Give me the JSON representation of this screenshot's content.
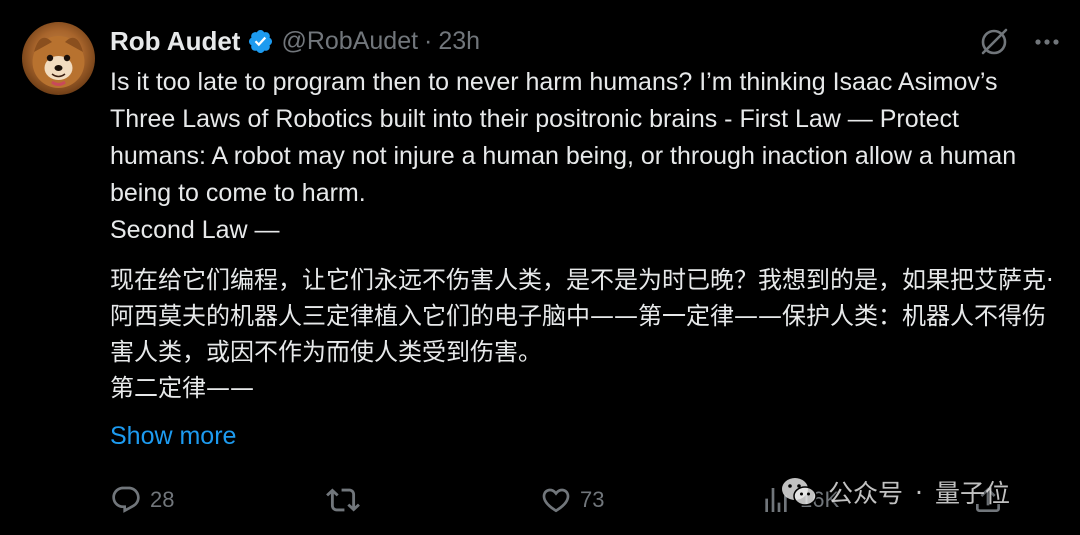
{
  "tweet": {
    "author": {
      "display_name": "Rob Audet",
      "handle": "@RobAudet",
      "separator": "·",
      "time": "23h",
      "verified": true,
      "avatar_icon": "dog-avatar"
    },
    "text_en": [
      "Is it too late to program then to never harm humans? I’m thinking Isaac Asimov’s Three Laws of Robotics built into their positronic brains - First Law — Protect humans: A robot may not injure a human being, or through inaction allow a human being to come to harm.",
      "Second Law —"
    ],
    "text_zh": [
      "现在给它们编程，让它们永远不伤害人类，是不是为时已晚？我想到的是，如果把艾萨克·阿西莫夫的机器人三定律植入它们的电子脑中——第一定律——保护人类：机器人不得伤害人类，或因不作为而使人类受到伤害。",
      "第二定律——"
    ],
    "show_more": "Show more",
    "actions": {
      "reply_count": "28",
      "retweet_count": "",
      "like_count": "73",
      "views_count": "16K"
    }
  },
  "watermark": {
    "text_left": "公众号",
    "separator": "·",
    "text_right": "量子位"
  },
  "colors": {
    "background": "#000000",
    "text": "#e7e9ea",
    "muted": "#71767b",
    "link": "#1d9bf0",
    "verified": "#1d9bf0"
  }
}
